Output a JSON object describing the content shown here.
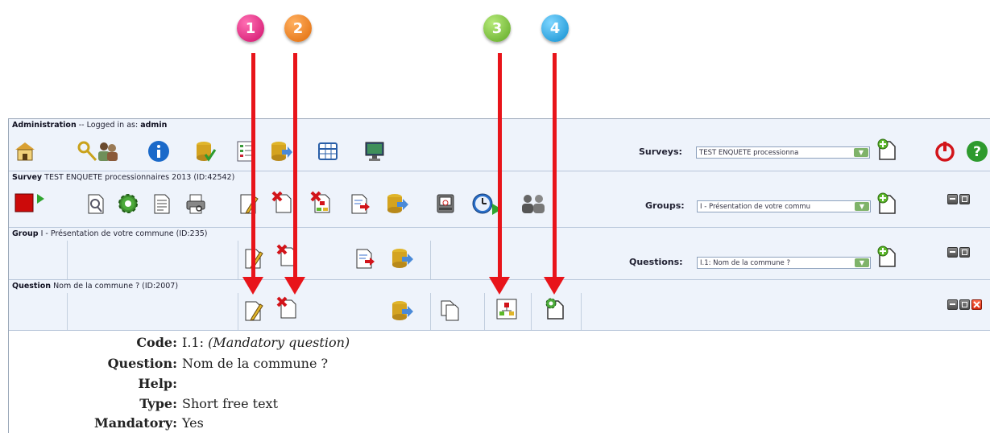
{
  "callouts": [
    "1",
    "2",
    "3",
    "4"
  ],
  "callout_colors": [
    "#e0197d",
    "#f07b16",
    "#7cc13a",
    "#1ea4e2"
  ],
  "admin_bar": {
    "title": "Administration",
    "sep": "-- Logged in as:",
    "user": "admin",
    "surveys_label": "Surveys:",
    "surveys_value": "TEST ENQUETE processionna"
  },
  "survey_bar": {
    "title": "Survey",
    "name": "TEST ENQUETE processionnaires 2013 (ID:42542)",
    "groups_label": "Groups:",
    "groups_value": "I - Présentation de votre commu"
  },
  "group_bar": {
    "title": "Group",
    "name": "I - Présentation de votre commune (ID:235)",
    "questions_label": "Questions:",
    "questions_value": "I.1: Nom de la commune ?"
  },
  "question_bar": {
    "title": "Question",
    "name": "Nom de la commune ? (ID:2007)"
  },
  "details": {
    "code_label": "Code:",
    "code_value": "I.1:",
    "code_note": "(Mandatory question)",
    "question_label": "Question:",
    "question_value": "Nom de la commune ?",
    "help_label": "Help:",
    "help_value": "",
    "type_label": "Type:",
    "type_value": "Short free text",
    "mandatory_label": "Mandatory:",
    "mandatory_value": "Yes"
  },
  "icons": {
    "admin": [
      "home-icon",
      "keys-users-icon",
      "info-icon",
      "database-check-icon",
      "checklist-icon",
      "database-export-icon",
      "table-grid-icon",
      "monitor-icon"
    ],
    "survey": [
      "stop-play-icon",
      "survey-preview-icon",
      "settings-gear-icon",
      "document-text-icon",
      "print-preview-icon",
      "edit-survey-icon",
      "delete-survey-icon",
      "delete-tree-icon",
      "export-document-icon",
      "export-database-icon",
      "scale-icon",
      "clock-play-icon",
      "participants-icon"
    ],
    "group": [
      "edit-group-icon",
      "delete-group-icon",
      "export-group-document-icon",
      "export-group-database-icon"
    ],
    "question": [
      "edit-question-icon",
      "delete-question-icon",
      "export-question-icon",
      "copy-question-icon",
      "condition-tree-icon",
      "answer-options-icon"
    ],
    "right": [
      "add-survey-icon",
      "logout-icon",
      "help-icon",
      "add-group-icon",
      "add-question-icon"
    ]
  }
}
